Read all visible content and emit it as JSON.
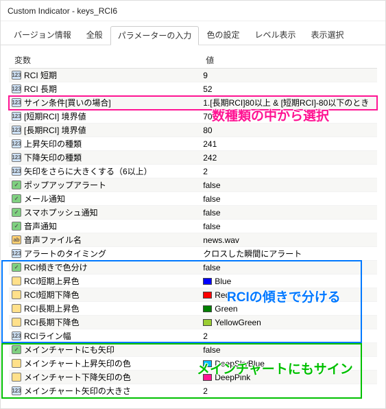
{
  "window": {
    "title": "Custom Indicator - keys_RCI6"
  },
  "tabs": [
    {
      "label": "バージョン情報"
    },
    {
      "label": "全般"
    },
    {
      "label": "パラメーターの入力"
    },
    {
      "label": "色の設定"
    },
    {
      "label": "レベル表示"
    },
    {
      "label": "表示選択"
    }
  ],
  "cols": {
    "name": "変数",
    "value": "値"
  },
  "rows": [
    {
      "ico": "num",
      "name": "RCI 短期",
      "value": "9"
    },
    {
      "ico": "num",
      "name": "RCI 長期",
      "value": "52"
    },
    {
      "ico": "num",
      "name": "サイン条件[買いの場合]",
      "value": "1.[長期RCI]80以上 & [短期RCI]-80以下のとき",
      "hl": "red"
    },
    {
      "ico": "num",
      "name": "[短期RCI] 境界値",
      "value": "70"
    },
    {
      "ico": "num",
      "name": "[長期RCI] 境界値",
      "value": "80"
    },
    {
      "ico": "num",
      "name": "上昇矢印の種類",
      "value": "241"
    },
    {
      "ico": "num",
      "name": "下降矢印の種類",
      "value": "242"
    },
    {
      "ico": "num",
      "name": "矢印をさらに大きくする（6以上）",
      "value": "2"
    },
    {
      "ico": "green",
      "name": "ポップアップアラート",
      "value": "false"
    },
    {
      "ico": "green",
      "name": "メール通知",
      "value": "false"
    },
    {
      "ico": "green",
      "name": "スマホプッシュ通知",
      "value": "false"
    },
    {
      "ico": "green",
      "name": "音声通知",
      "value": "false"
    },
    {
      "ico": "orange",
      "name": "音声ファイル名",
      "value": "news.wav"
    },
    {
      "ico": "num",
      "name": "アラートのタイミング",
      "value": "クロスした瞬間にアラート"
    },
    {
      "ico": "green",
      "name": "RCI傾きで色分け",
      "value": "false"
    },
    {
      "ico": "yellow",
      "name": "RCI短期上昇色",
      "value": "Blue",
      "swatch": "#0000ff"
    },
    {
      "ico": "yellow",
      "name": "RCI短期下降色",
      "value": "Red",
      "swatch": "#ff0000"
    },
    {
      "ico": "yellow",
      "name": "RCI長期上昇色",
      "value": "Green",
      "swatch": "#008000"
    },
    {
      "ico": "yellow",
      "name": "RCI長期下降色",
      "value": "YellowGreen",
      "swatch": "#9acd32"
    },
    {
      "ico": "num",
      "name": "RCIライン幅",
      "value": "2"
    },
    {
      "ico": "green",
      "name": "メインチャートにも矢印",
      "value": "false"
    },
    {
      "ico": "yellow",
      "name": "メインチャート上昇矢印の色",
      "value": "DeepSkyBlue",
      "swatch": "#00bfff"
    },
    {
      "ico": "yellow",
      "name": "メインチャート下降矢印の色",
      "value": "DeepPink",
      "swatch": "#ff1493"
    },
    {
      "ico": "num",
      "name": "メインチャート矢印の大きさ",
      "value": "2"
    }
  ],
  "annots": {
    "select": "数種類の中から選択",
    "tilt": "RCIの傾きで分ける",
    "main": "メインチャートにもサイン"
  },
  "icotext": {
    "num": "123",
    "green": "✓",
    "yellow": "",
    "orange": "ab"
  }
}
